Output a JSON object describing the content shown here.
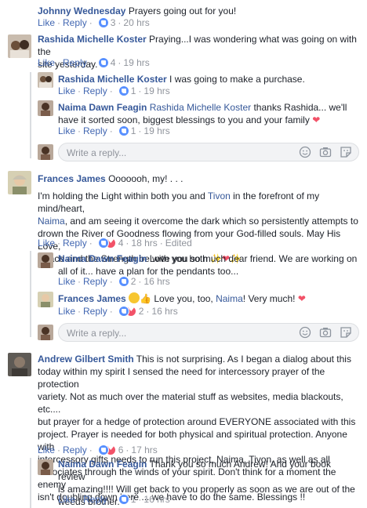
{
  "comments": [
    {
      "id": "c1",
      "author": "Johnny Wednesday",
      "text": " Prayers going out for you!",
      "like": "Like",
      "reply": "Reply",
      "count": "3",
      "time": "20 hrs"
    },
    {
      "id": "c2",
      "author": "Rashida Michelle Koster",
      "text_line1": " Praying...I was wondering what was going on with the",
      "text_line2": "site yesterday.",
      "like": "Like",
      "reply": "Reply",
      "count": "4",
      "time": "19 hrs"
    },
    {
      "id": "c3",
      "author": "Rashida Michelle Koster",
      "text": " I was going to make a purchase.",
      "like": "Like",
      "reply": "Reply",
      "count": "1",
      "time": "19 hrs"
    },
    {
      "id": "c4",
      "author": "Naima Dawn Feagin",
      "mention": "Rashida Michelle Koster",
      "text_line1": " thanks Rashida... we'll",
      "text_line2": "have it sorted soon, biggest blessings to you and your family",
      "like": "Like",
      "reply": "Reply",
      "count": "1",
      "time": "19 hrs"
    },
    {
      "id": "c5",
      "author": "Frances James",
      "text_head": " Ooooooh, my! . . .",
      "p1a": "I'm holding the Light within both you and ",
      "mention1": "Tivon",
      "p1b": " in the forefront of my mind/heart,",
      "mention2": "Naima",
      "p2": ", and am seeing it overcome the dark which so persistently attempts to",
      "p3": "drown the River of Goodness flowing from your God-filled souls. May His Love,",
      "p4": "Peace and the Strength be with you both ",
      "like": "Like",
      "reply": "Reply",
      "count": "4",
      "time": "18 hrs",
      "edited": "Edited"
    },
    {
      "id": "c6",
      "author": "Naima Dawn Feagin",
      "text_line1": " Love you so much dear friend. We are working on",
      "text_line2": "all of it... have a plan for the pendants too...",
      "like": "Like",
      "reply": "Reply",
      "count": "2",
      "time": "16 hrs"
    },
    {
      "id": "c7",
      "author": "Frances James",
      "text_a": " Love you, too, ",
      "mention": "Naima",
      "text_b": "! Very much! ",
      "like": "Like",
      "reply": "Reply",
      "count": "2",
      "time": "16 hrs"
    },
    {
      "id": "c8",
      "author": "Andrew Gilbert Smith",
      "lines": [
        " This is not surprising. As I began a dialog about this",
        "today within my spirit I sensed the need for intercessory prayer of the protection",
        "variety. Not as much over the material stuff as websites, media blackouts, etc....",
        "but prayer for a hedge of protection around EVERYONE associated with this",
        "project. Prayer is needed for both physical and spiritual protection. Anyone with",
        "intercessory gifts needs to run this project, Naima, Tivon, as well as all",
        "associates through the winds of your spirit. Don't think for a moment the enemy",
        "isn't doubling down here ... we have to do the same. Blessings !!"
      ],
      "like": "Like",
      "reply": "Reply",
      "count": "6",
      "time": "17 hrs"
    },
    {
      "id": "c9",
      "author": "Naima Dawn Feagin",
      "text_line1": " Thank you so much Andrew! And your book review",
      "text_line2": "is amazing!!!! Will get back to you properly as soon as we are out of the",
      "text_line3": "weeds brother.",
      "like": "Like",
      "reply": "Reply",
      "count": "1",
      "time": "16 hrs"
    }
  ],
  "reply_box": {
    "placeholder": "Write a reply..."
  },
  "icons": {
    "emoji": "smiley-icon",
    "camera": "camera-icon",
    "sticker": "sticker-icon",
    "like": "like-reaction-icon",
    "love": "love-reaction-icon"
  },
  "colors": {
    "link": "#365899",
    "action": "#4267b2",
    "meta": "#90949c",
    "like_blue": "#5890ff",
    "love_red": "#f25268"
  }
}
